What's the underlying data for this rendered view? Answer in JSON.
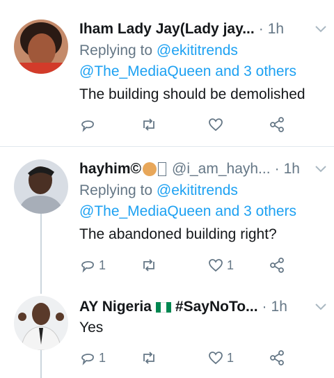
{
  "tweets": [
    {
      "name": "Iham Lady Jay(Lady jay...",
      "handle": "",
      "time": "1h",
      "replying_label": "Replying to ",
      "replying_to": "@ekititrends",
      "replying_others": "@The_MediaQueen and 3 others",
      "text": "The building should be demolished",
      "reply_count": "",
      "like_count": ""
    },
    {
      "name": "hayhim©",
      "handle": "@i_am_hayh...",
      "time": "1h",
      "replying_label": "Replying to ",
      "replying_to": "@ekititrends",
      "replying_others": "@The_MediaQueen and 3 others",
      "text": "The abandoned building right?",
      "reply_count": "1",
      "like_count": "1"
    },
    {
      "name": "AY Nigeria",
      "name_suffix": "#SayNoTo...",
      "time": "1h",
      "text": "Yes",
      "reply_count": "1",
      "like_count": "1"
    }
  ],
  "separator": "·",
  "colors": {
    "link": "#1da1f2",
    "muted": "#657786",
    "divider": "#e1e8ed",
    "flag_green": "#008751",
    "flag_white": "#ffffff"
  },
  "icons": [
    "reply-icon",
    "retweet-icon",
    "like-icon",
    "share-icon",
    "chevron-down-icon"
  ]
}
